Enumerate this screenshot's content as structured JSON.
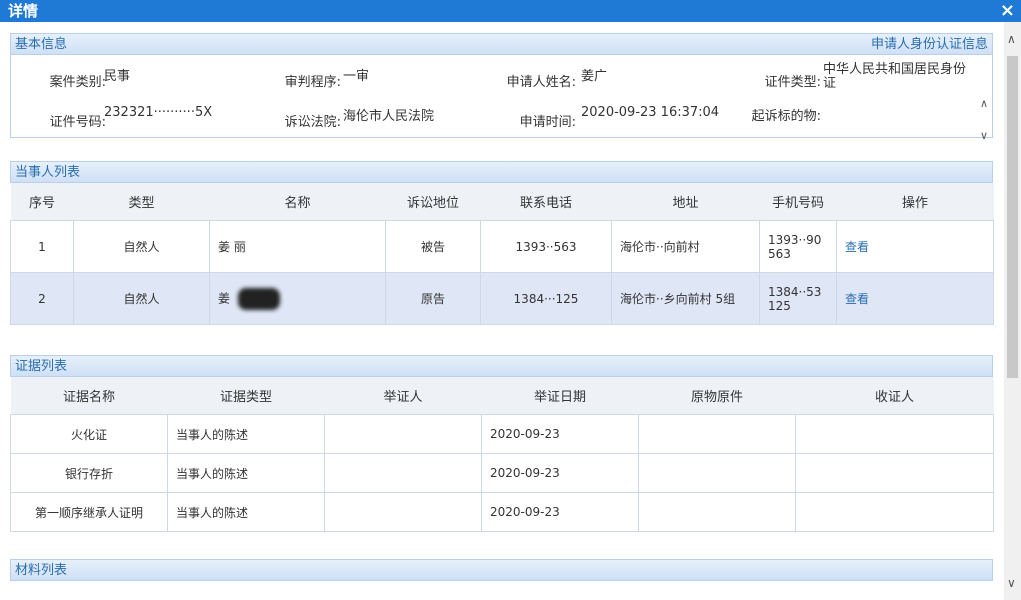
{
  "window": {
    "title": "详情",
    "close_icon": "×"
  },
  "basic_info": {
    "header": "基本信息",
    "id_link": "申请人身份认证信息",
    "fields": {
      "case_type": {
        "label": "案件类别:",
        "value": "民事"
      },
      "procedure": {
        "label": "审判程序:",
        "value": "一审"
      },
      "applicant": {
        "label": "申请人姓名:",
        "value": "姜广"
      },
      "id_type": {
        "label": "证件类型:",
        "value": "中华人民共和国居民身份证"
      },
      "id_number": {
        "label": "证件号码:",
        "value": "232321··········5X"
      },
      "court": {
        "label": "诉讼法院:",
        "value": "海伦市人民法院"
      },
      "apply_time": {
        "label": "申请时间:",
        "value": "2020-09-23 16:37:04"
      },
      "claim_subject": {
        "label": "起诉标的物:",
        "value": ""
      }
    }
  },
  "parties": {
    "header": "当事人列表",
    "columns": [
      "序号",
      "类型",
      "名称",
      "诉讼地位",
      "联系电话",
      "地址",
      "手机号码",
      "操作"
    ],
    "rows": [
      {
        "no": "1",
        "type": "自然人",
        "name": "姜 丽",
        "role": "被告",
        "phone": "1393··563",
        "address": "海伦市··向前村",
        "mobile": "1393··90 563",
        "action": "查看"
      },
      {
        "no": "2",
        "type": "自然人",
        "name": "姜",
        "role": "原告",
        "phone": "1384···125",
        "address": "海伦市··乡向前村 5组",
        "mobile": "1384··53 125",
        "action": "查看"
      }
    ]
  },
  "evidence": {
    "header": "证据列表",
    "columns": [
      "证据名称",
      "证据类型",
      "举证人",
      "举证日期",
      "原物原件",
      "收证人"
    ],
    "rows": [
      {
        "name": "火化证",
        "type": "当事人的陈述",
        "provider": "",
        "date": "2020-09-23",
        "original": "",
        "receiver": ""
      },
      {
        "name": "银行存折",
        "type": "当事人的陈述",
        "provider": "",
        "date": "2020-09-23",
        "original": "",
        "receiver": ""
      },
      {
        "name": "第一顺序继承人证明",
        "type": "当事人的陈述",
        "provider": "",
        "date": "2020-09-23",
        "original": "",
        "receiver": ""
      }
    ]
  },
  "materials": {
    "header": "材料列表"
  },
  "icons": {
    "close": "close-icon",
    "scroll_up": "chevron-up-icon",
    "scroll_down": "chevron-down-icon"
  },
  "colors": {
    "title_bar": "#1f7ad6",
    "section_header": "#cfe0f5",
    "link": "#2a6db0",
    "alt_row": "#dfe6f5"
  }
}
